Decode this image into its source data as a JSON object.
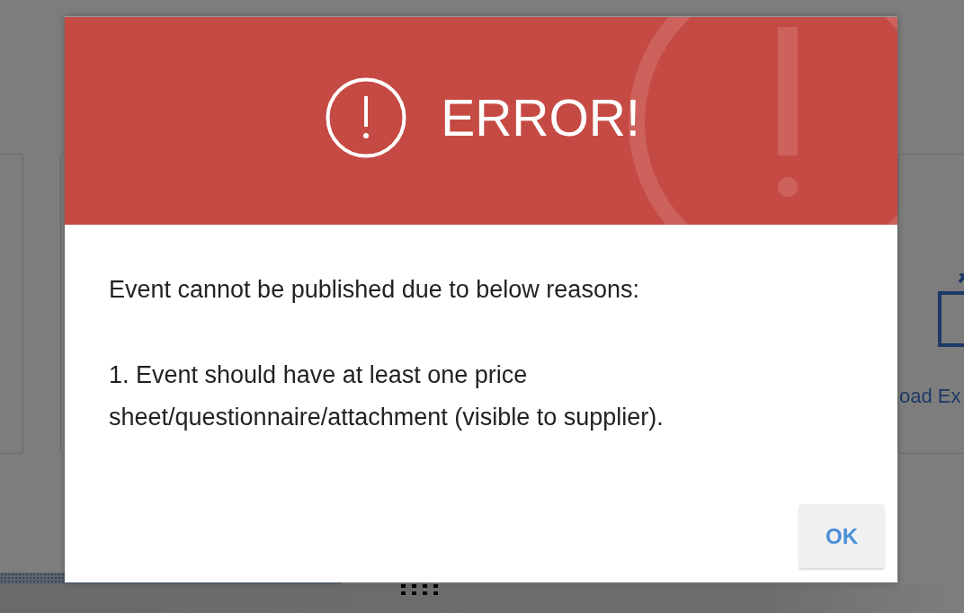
{
  "background": {
    "card_label": "oad Ex"
  },
  "dialog": {
    "title": "ERROR!",
    "message": "Event cannot be published due to below reasons:",
    "reasons": [
      "1. Event should have at least one price sheet/questionnaire/attachment (visible to supplier)."
    ],
    "buttons": [
      "OK"
    ]
  }
}
